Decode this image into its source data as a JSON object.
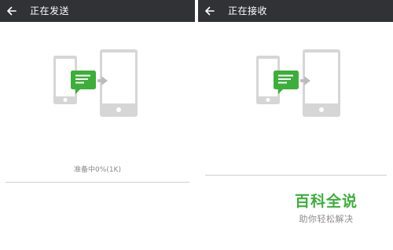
{
  "colors": {
    "topbar_bg": "#313236",
    "topbar_text": "#ffffff",
    "background": "#ffffff",
    "device_gray": "#d6d6d6",
    "device_screen": "#ffffff",
    "arrow_gray": "#bbbbbb",
    "chat_green": "#3cae3a",
    "status_text": "#8a8a8a",
    "line_gray": "#cfcfcf",
    "watermark_green": "#3cae3a",
    "watermark_gray": "#8c8c8c"
  },
  "left_panel": {
    "back_icon": "arrow-left-icon",
    "title": "正在发送",
    "illustration_icons": [
      "phone-icon",
      "chat-bubble-icon",
      "arrow-right-icon",
      "tablet-icon"
    ],
    "status_text": "准备中0%(1K)"
  },
  "right_panel": {
    "back_icon": "arrow-left-icon",
    "title": "正在接收",
    "illustration_icons": [
      "phone-icon",
      "chat-bubble-icon",
      "arrow-right-icon",
      "tablet-icon"
    ]
  },
  "watermark": {
    "title": "百科全说",
    "subtitle": "助你轻松解决"
  }
}
